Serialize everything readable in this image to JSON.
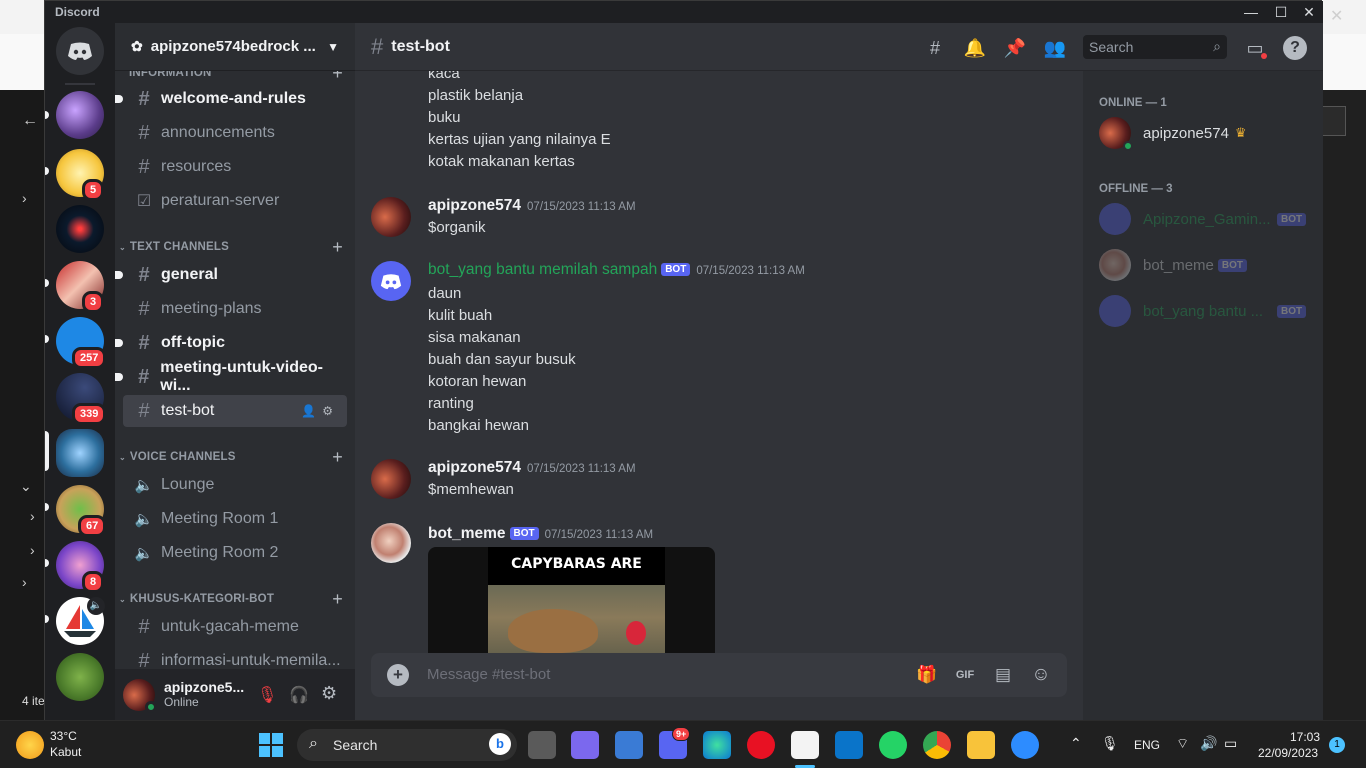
{
  "window": {
    "title": "Discord"
  },
  "background": {
    "items_label": "4 ite"
  },
  "guilds": {
    "badges": [
      "5",
      "3",
      "257",
      "339",
      "67",
      "8"
    ]
  },
  "server": {
    "name": "apipzone574bedrock ..."
  },
  "channels": {
    "top_partial": "INFORMATION",
    "info": [
      {
        "name": "welcome-and-rules"
      },
      {
        "name": "announcements"
      },
      {
        "name": "resources"
      },
      {
        "name": "peraturan-server"
      }
    ],
    "text_category": "TEXT CHANNELS",
    "text": [
      {
        "name": "general"
      },
      {
        "name": "meeting-plans"
      },
      {
        "name": "off-topic"
      },
      {
        "name": "meeting-untuk-video-wi..."
      },
      {
        "name": "test-bot"
      }
    ],
    "voice_category": "VOICE CHANNELS",
    "voice": [
      {
        "name": "Lounge"
      },
      {
        "name": "Meeting Room 1"
      },
      {
        "name": "Meeting Room 2"
      }
    ],
    "bot_category": "KHUSUS-KATEGORI-BOT",
    "bot": [
      {
        "name": "untuk-gacah-meme"
      },
      {
        "name": "informasi-untuk-memila..."
      }
    ]
  },
  "user": {
    "name": "apipzone5...",
    "status": "Online"
  },
  "header": {
    "channel": "test-bot",
    "search_placeholder": "Search"
  },
  "messages": {
    "continued": [
      "kaca",
      "plastik belanja",
      "buku",
      "kertas ujian yang nilainya E",
      "kotak makanan kertas"
    ],
    "m1": {
      "author": "apipzone574",
      "time": "07/15/2023 11:13 AM",
      "text": "$organik"
    },
    "m2": {
      "author": "bot_yang bantu memilah sampah",
      "badge": "BOT",
      "time": "07/15/2023 11:13 AM",
      "lines": [
        "daun",
        "kulit buah",
        "sisa makanan",
        "buah dan sayur busuk",
        "kotoran hewan",
        "ranting",
        "bangkai hewan"
      ]
    },
    "m3": {
      "author": "apipzone574",
      "time": "07/15/2023 11:13 AM",
      "text": "$memhewan"
    },
    "m4": {
      "author": "bot_meme",
      "badge": "BOT",
      "time": "07/15/2023 11:13 AM",
      "image_caption": "CAPYBARAS ARE CHILL"
    }
  },
  "composer": {
    "placeholder": "Message #test-bot",
    "gif": "GIF"
  },
  "members": {
    "online_header": "ONLINE — 1",
    "online": [
      {
        "name": "apipzone574"
      }
    ],
    "offline_header": "OFFLINE — 3",
    "offline": [
      {
        "name": "Apipzone_Gamin...",
        "badge": "BOT"
      },
      {
        "name": "bot_meme",
        "badge": "BOT"
      },
      {
        "name": "bot_yang bantu ...",
        "badge": "BOT"
      }
    ]
  },
  "taskbar": {
    "weather_temp": "33°C",
    "weather_desc": "Kabut",
    "search": "Search",
    "lang": "ENG",
    "time": "17:03",
    "date": "22/09/2023",
    "notif": "1",
    "discord_badge": "9+"
  },
  "colors": {
    "blurple": "#5865f2",
    "green_name": "#23a559",
    "badge_red": "#f23f43",
    "online": "#23a559"
  }
}
